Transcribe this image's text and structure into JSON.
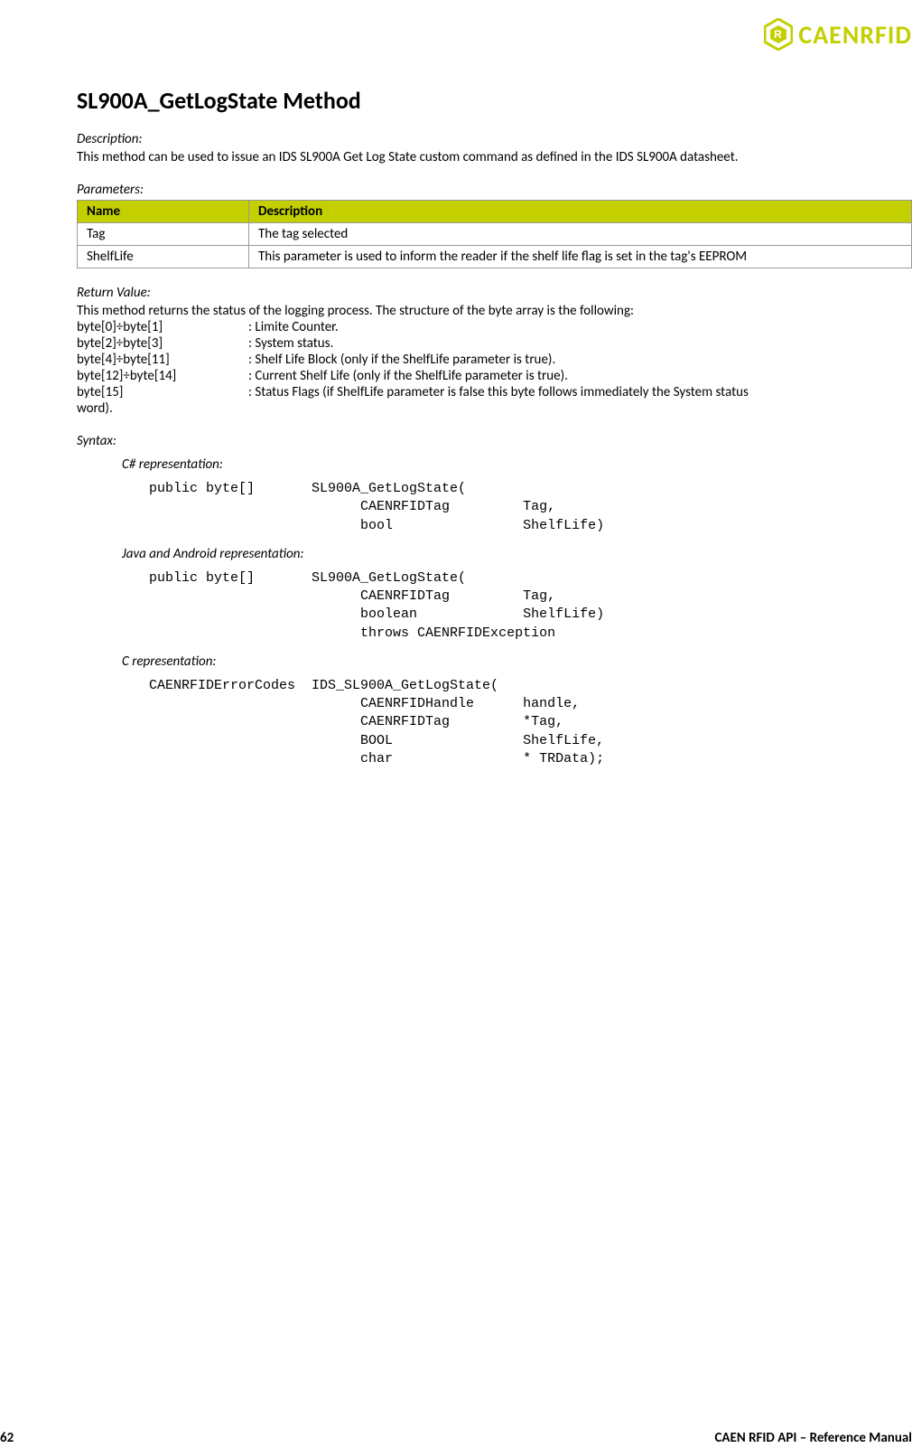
{
  "logo": {
    "text": "CAENRFID"
  },
  "title": "SL900A_GetLogState Method",
  "description": {
    "label": "Description:",
    "text": "This method can be used to issue an IDS SL900A Get Log State custom command as defined in the IDS SL900A datasheet."
  },
  "parameters": {
    "label": "Parameters:",
    "headers": {
      "name": "Name",
      "desc": "Description"
    },
    "rows": [
      {
        "name": "Tag",
        "desc": "The tag selected"
      },
      {
        "name": "ShelfLife",
        "desc": "This parameter is used to inform the reader if the shelf life flag is set in the tag's EEPROM"
      }
    ]
  },
  "return": {
    "label": "Return Value:",
    "intro": "This method returns the status of the logging process. The structure of the byte array is the following:",
    "lines": [
      {
        "k": "byte[0]÷byte[1]",
        "v": ": Limite Counter."
      },
      {
        "k": "byte[2]÷byte[3]",
        "v": ": System status."
      },
      {
        "k": "byte[4]÷byte[11]",
        "v": ": Shelf Life Block (only if the ShelfLife parameter is true)."
      },
      {
        "k": "byte[12]÷byte[14]",
        "v": ": Current Shelf Life (only if the ShelfLife parameter is true)."
      },
      {
        "k": "byte[15]",
        "v": ": Status Flags (if ShelfLife parameter is false this byte follows immediately the System status"
      },
      {
        "k": "word).",
        "v": ""
      }
    ]
  },
  "syntax": {
    "label": "Syntax:",
    "repr": [
      {
        "label": "C# representation:",
        "code": "public byte[]       SL900A_GetLogState(\n                          CAENRFIDTag         Tag,\n                          bool                ShelfLife)"
      },
      {
        "label": "Java and Android representation:",
        "code": "public byte[]       SL900A_GetLogState(\n                          CAENRFIDTag         Tag,\n                          boolean             ShelfLife)\n                          throws CAENRFIDException"
      },
      {
        "label": "C representation:",
        "code": "CAENRFIDErrorCodes  IDS_SL900A_GetLogState(\n                          CAENRFIDHandle      handle,\n                          CAENRFIDTag         *Tag,\n                          BOOL                ShelfLife,\n                          char                * TRData);"
      }
    ]
  },
  "footer": {
    "page": "62",
    "title": "CAEN RFID API – Reference Manual"
  }
}
